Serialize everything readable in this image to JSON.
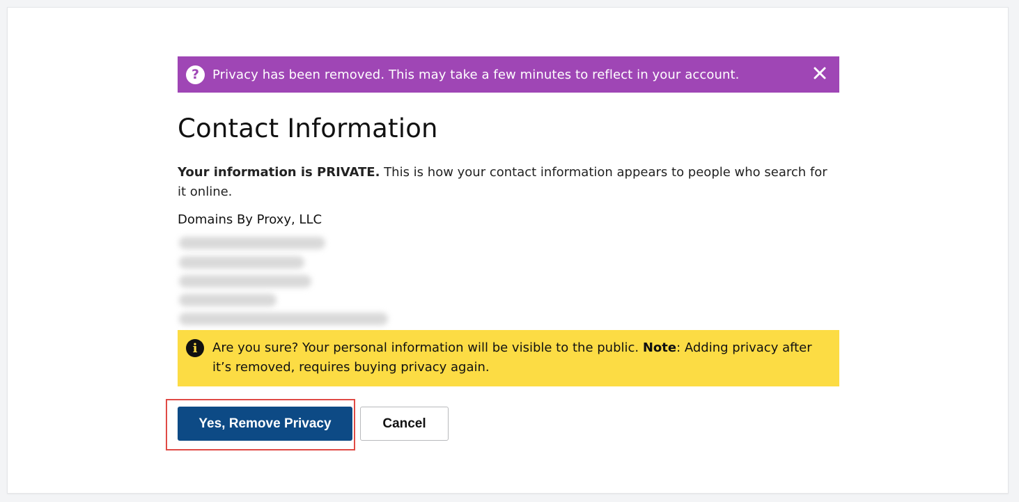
{
  "alert": {
    "icon": "question-circle-icon",
    "message": "Privacy has been removed. This may take a few minutes to reflect in your account.",
    "close_icon": "close-icon",
    "color": "#9f46b5"
  },
  "page": {
    "title": "Contact Information",
    "description_bold": "Your information is PRIVATE.",
    "description_rest": " This is how your contact information appears to people who search for it online.",
    "organization": "Domains By Proxy, LLC"
  },
  "warning": {
    "icon": "info-circle-icon",
    "text_before": "Are you sure? Your personal information will be visible to the public. ",
    "note_label": "Note",
    "text_after": ": Adding privacy after it’s removed, requires buying privacy again.",
    "color": "#fcdc44"
  },
  "actions": {
    "confirm_label": "Yes, Remove Privacy",
    "cancel_label": "Cancel",
    "confirm_color": "#0d4a85",
    "highlight_color": "#e04a45"
  }
}
